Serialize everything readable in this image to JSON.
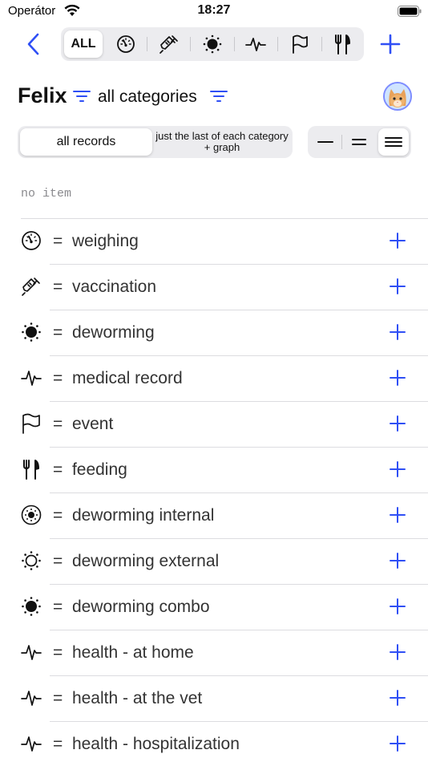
{
  "status": {
    "carrier": "Operátor",
    "time": "18:27"
  },
  "nav": {
    "all_label": "ALL"
  },
  "header": {
    "pet_name": "Felix",
    "category_filter": "all categories"
  },
  "view": {
    "all_records": "all records",
    "last_each": "just the last of each category + graph"
  },
  "empty_text": "no item",
  "items": [
    {
      "icon": "gauge-icon",
      "eq": "=",
      "label": "weighing"
    },
    {
      "icon": "syringe-icon",
      "eq": "=",
      "label": "vaccination"
    },
    {
      "icon": "sun-dots-icon",
      "eq": "=",
      "label": "deworming"
    },
    {
      "icon": "pulse-icon",
      "eq": "=",
      "label": "medical record"
    },
    {
      "icon": "flag-icon",
      "eq": "=",
      "label": "event"
    },
    {
      "icon": "fork-knife-icon",
      "eq": "=",
      "label": "feeding"
    },
    {
      "icon": "circle-sun-icon",
      "eq": "=",
      "label": "deworming internal"
    },
    {
      "icon": "sun-outline-icon",
      "eq": "=",
      "label": "deworming external"
    },
    {
      "icon": "sun-dots-icon",
      "eq": "=",
      "label": "deworming combo"
    },
    {
      "icon": "pulse-icon",
      "eq": "=",
      "label": "health - at home"
    },
    {
      "icon": "pulse-icon",
      "eq": "=",
      "label": "health - at the vet"
    },
    {
      "icon": "pulse-icon",
      "eq": "=",
      "label": "health - hospitalization"
    }
  ],
  "colors": {
    "accent": "#2f4ff5",
    "text": "#111111",
    "segment_bg": "#ececef"
  }
}
